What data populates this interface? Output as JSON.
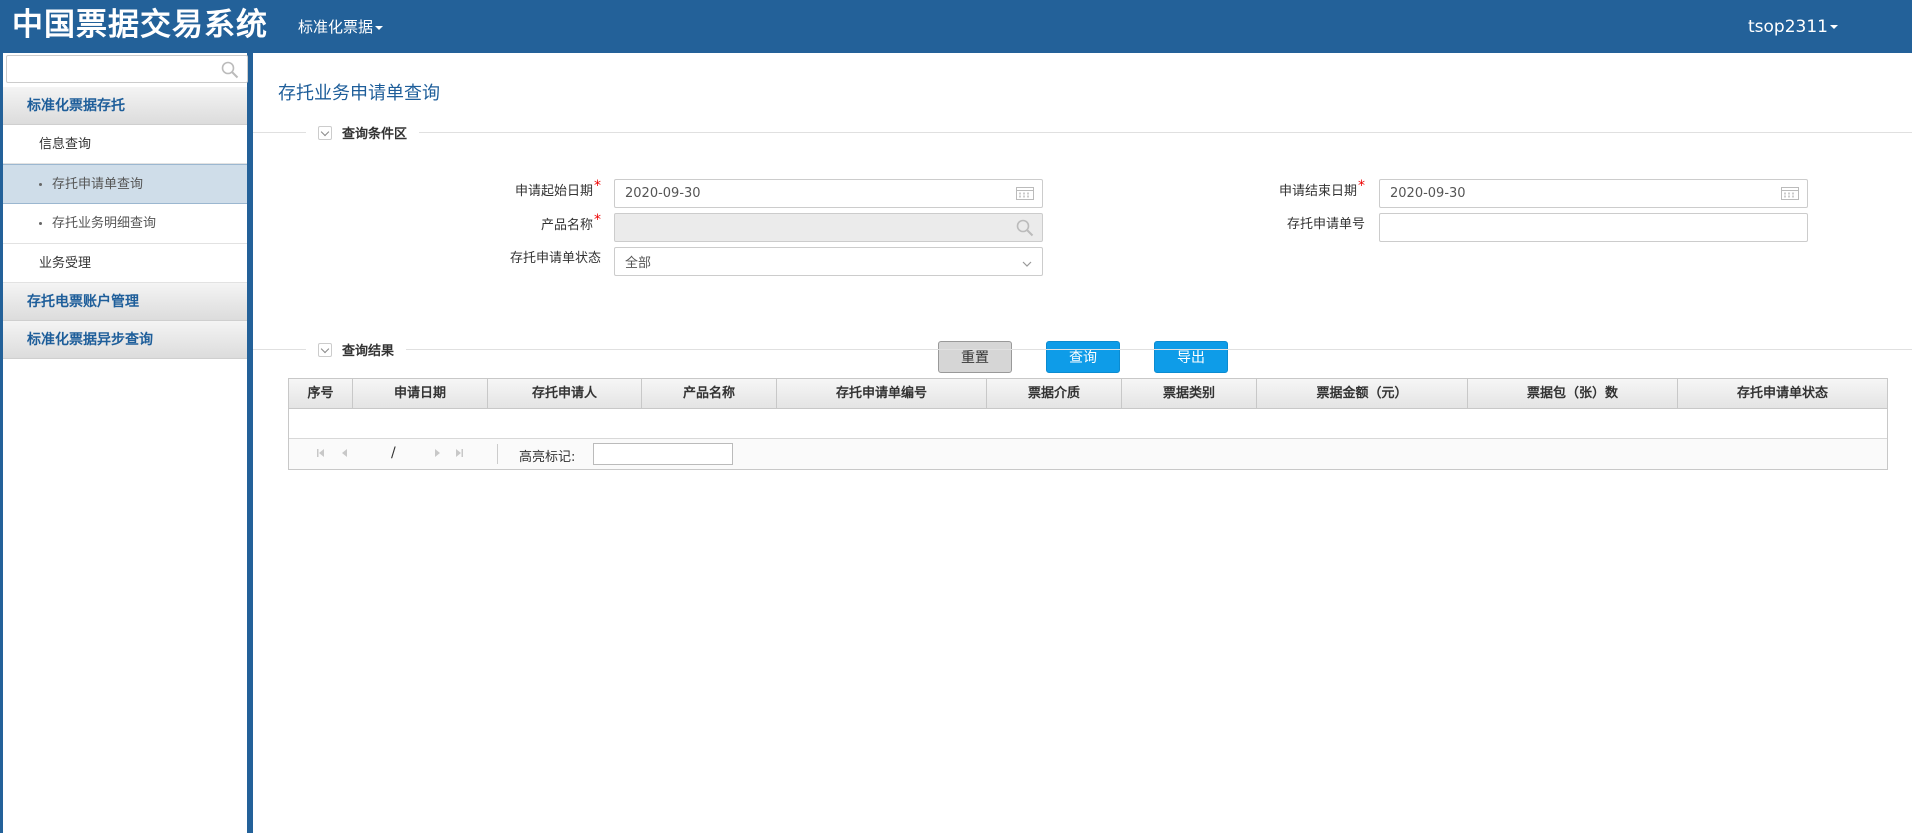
{
  "header": {
    "app_title": "中国票据交易系统",
    "menu_label": "标准化票据",
    "user_label": "tsop2311"
  },
  "sidebar": {
    "search_placeholder": "",
    "groups": [
      {
        "label": "标准化票据存托"
      },
      {
        "label": "存托电票账户管理"
      },
      {
        "label": "标准化票据异步查询"
      }
    ],
    "subs": [
      {
        "label": "信息查询"
      },
      {
        "label": "业务受理"
      }
    ],
    "leaves": [
      {
        "label": "存托申请单查询",
        "active": true
      },
      {
        "label": "存托业务明细查询",
        "active": false
      }
    ]
  },
  "main": {
    "page_title": "存托业务申请单查询",
    "query_section": "查询条件区",
    "result_section": "查询结果",
    "fields": {
      "start_date_label": "申请起始日期",
      "start_date_value": "2020-09-30",
      "end_date_label": "申请结束日期",
      "end_date_value": "2020-09-30",
      "product_label": "产品名称",
      "product_value": "",
      "app_no_label": "存托申请单号",
      "app_no_value": "",
      "status_label": "存托申请单状态",
      "status_value": "全部",
      "required_mark": "*"
    },
    "buttons": {
      "reset": "重置",
      "query": "查询",
      "export": "导出"
    },
    "table": {
      "columns": [
        "序号",
        "申请日期",
        "存托申请人",
        "产品名称",
        "存托申请单编号",
        "票据介质",
        "票据类别",
        "票据金额（元）",
        "票据包（张）数",
        "存托申请单状态"
      ],
      "rows": []
    },
    "pager": {
      "page_sep": "/",
      "highlight_label": "高亮标记:",
      "highlight_value": ""
    }
  },
  "colors": {
    "header_bg": "#236199",
    "accent_blue": "#0e9ce8",
    "link_blue": "#1e5e9a",
    "required": "#e00000"
  }
}
